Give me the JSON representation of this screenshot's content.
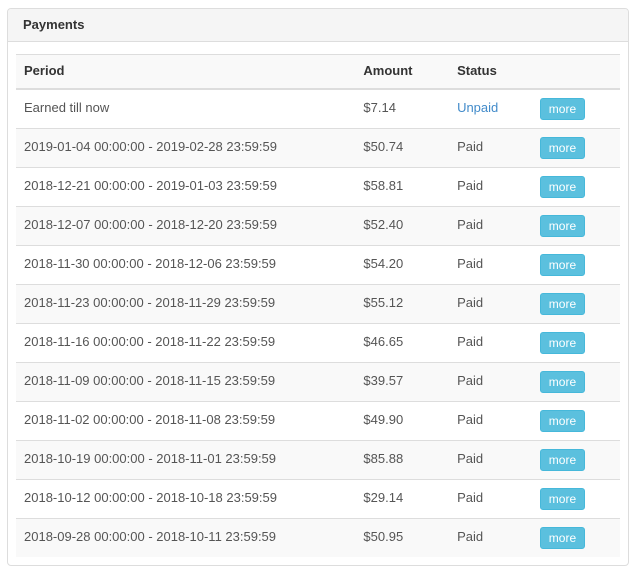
{
  "panel": {
    "title": "Payments"
  },
  "table": {
    "columns": [
      {
        "label": "Period"
      },
      {
        "label": "Amount"
      },
      {
        "label": "Status"
      },
      {
        "label": ""
      }
    ],
    "more_label": "more",
    "rows": [
      {
        "period": "Earned till now",
        "amount": "$7.14",
        "status": "Unpaid",
        "status_type": "unpaid"
      },
      {
        "period": "2019-01-04 00:00:00 - 2019-02-28 23:59:59",
        "amount": "$50.74",
        "status": "Paid",
        "status_type": "paid"
      },
      {
        "period": "2018-12-21 00:00:00 - 2019-01-03 23:59:59",
        "amount": "$58.81",
        "status": "Paid",
        "status_type": "paid"
      },
      {
        "period": "2018-12-07 00:00:00 - 2018-12-20 23:59:59",
        "amount": "$52.40",
        "status": "Paid",
        "status_type": "paid"
      },
      {
        "period": "2018-11-30 00:00:00 - 2018-12-06 23:59:59",
        "amount": "$54.20",
        "status": "Paid",
        "status_type": "paid"
      },
      {
        "period": "2018-11-23 00:00:00 - 2018-11-29 23:59:59",
        "amount": "$55.12",
        "status": "Paid",
        "status_type": "paid"
      },
      {
        "period": "2018-11-16 00:00:00 - 2018-11-22 23:59:59",
        "amount": "$46.65",
        "status": "Paid",
        "status_type": "paid"
      },
      {
        "period": "2018-11-09 00:00:00 - 2018-11-15 23:59:59",
        "amount": "$39.57",
        "status": "Paid",
        "status_type": "paid"
      },
      {
        "period": "2018-11-02 00:00:00 - 2018-11-08 23:59:59",
        "amount": "$49.90",
        "status": "Paid",
        "status_type": "paid"
      },
      {
        "period": "2018-10-19 00:00:00 - 2018-11-01 23:59:59",
        "amount": "$85.88",
        "status": "Paid",
        "status_type": "paid"
      },
      {
        "period": "2018-10-12 00:00:00 - 2018-10-18 23:59:59",
        "amount": "$29.14",
        "status": "Paid",
        "status_type": "paid"
      },
      {
        "period": "2018-09-28 00:00:00 - 2018-10-11 23:59:59",
        "amount": "$50.95",
        "status": "Paid",
        "status_type": "paid"
      }
    ]
  },
  "colors": {
    "accent_button": "#5bc0de",
    "accent_button_border": "#46b8da",
    "unpaid_link": "#428bca",
    "heading_bg": "#f5f5f5",
    "stripe_bg": "#f9f9f9",
    "border": "#dddddd"
  }
}
